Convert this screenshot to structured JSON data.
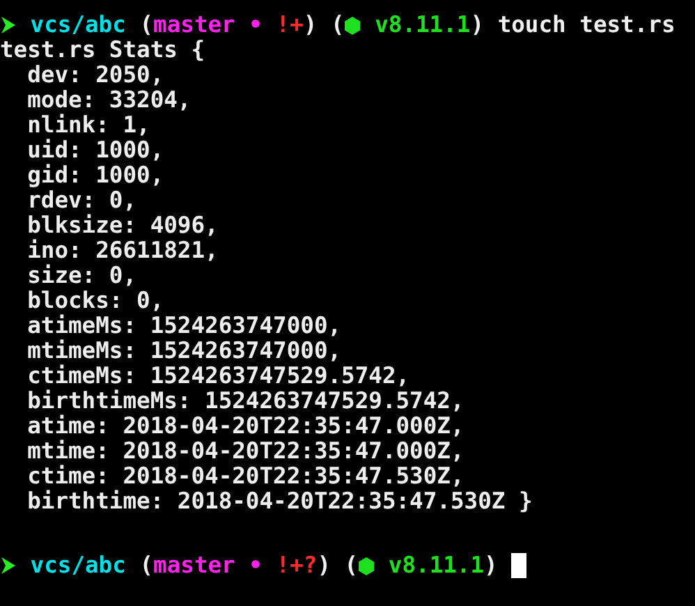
{
  "blocks": [
    {
      "prompt": [
        {
          "kind": "arrow",
          "space": false
        },
        {
          "kind": "path",
          "text": "vcs/abc",
          "space": true
        },
        {
          "kind": "punct",
          "text": "(",
          "space": true
        },
        {
          "kind": "branch",
          "text": "master",
          "space": false
        },
        {
          "kind": "separator",
          "text": "•",
          "space": true
        },
        {
          "kind": "status",
          "text": "!+",
          "space": true
        },
        {
          "kind": "punct",
          "text": ")",
          "space": false
        },
        {
          "kind": "punct",
          "text": "(",
          "space": true
        },
        {
          "kind": "node",
          "space": false
        },
        {
          "kind": "version",
          "text": "v8.11.1",
          "space": true
        },
        {
          "kind": "punct",
          "text": ")",
          "space": false
        },
        {
          "kind": "command",
          "text": "touch test.rs",
          "space": true
        }
      ],
      "output": [
        {
          "text": "test.rs Stats {",
          "indent": false
        },
        {
          "text": "dev: 2050,",
          "indent": true
        },
        {
          "text": "mode: 33204,",
          "indent": true
        },
        {
          "text": "nlink: 1,",
          "indent": true
        },
        {
          "text": "uid: 1000,",
          "indent": true
        },
        {
          "text": "gid: 1000,",
          "indent": true
        },
        {
          "text": "rdev: 0,",
          "indent": true
        },
        {
          "text": "blksize: 4096,",
          "indent": true
        },
        {
          "text": "ino: 26611821,",
          "indent": true
        },
        {
          "text": "size: 0,",
          "indent": true
        },
        {
          "text": "blocks: 0,",
          "indent": true
        },
        {
          "text": "atimeMs: 1524263747000,",
          "indent": true
        },
        {
          "text": "mtimeMs: 1524263747000,",
          "indent": true
        },
        {
          "text": "ctimeMs: 1524263747529.5742,",
          "indent": true
        },
        {
          "text": "birthtimeMs: 1524263747529.5742,",
          "indent": true
        },
        {
          "text": "atime: 2018-04-20T22:35:47.000Z,",
          "indent": true
        },
        {
          "text": "mtime: 2018-04-20T22:35:47.000Z,",
          "indent": true
        },
        {
          "text": "ctime: 2018-04-20T22:35:47.530Z,",
          "indent": true
        },
        {
          "text": "birthtime: 2018-04-20T22:35:47.530Z }",
          "indent": true
        }
      ]
    },
    {
      "prompt": [
        {
          "kind": "arrow",
          "space": false
        },
        {
          "kind": "path",
          "text": "vcs/abc",
          "space": true
        },
        {
          "kind": "punct",
          "text": "(",
          "space": true
        },
        {
          "kind": "branch",
          "text": "master",
          "space": false
        },
        {
          "kind": "separator",
          "text": "•",
          "space": true
        },
        {
          "kind": "status",
          "text": "!+?",
          "space": true
        },
        {
          "kind": "punct",
          "text": ")",
          "space": false
        },
        {
          "kind": "punct",
          "text": "(",
          "space": true
        },
        {
          "kind": "node",
          "space": false
        },
        {
          "kind": "version",
          "text": "v8.11.1",
          "space": true
        },
        {
          "kind": "punct",
          "text": ")",
          "space": false
        }
      ],
      "cursor": true
    }
  ]
}
